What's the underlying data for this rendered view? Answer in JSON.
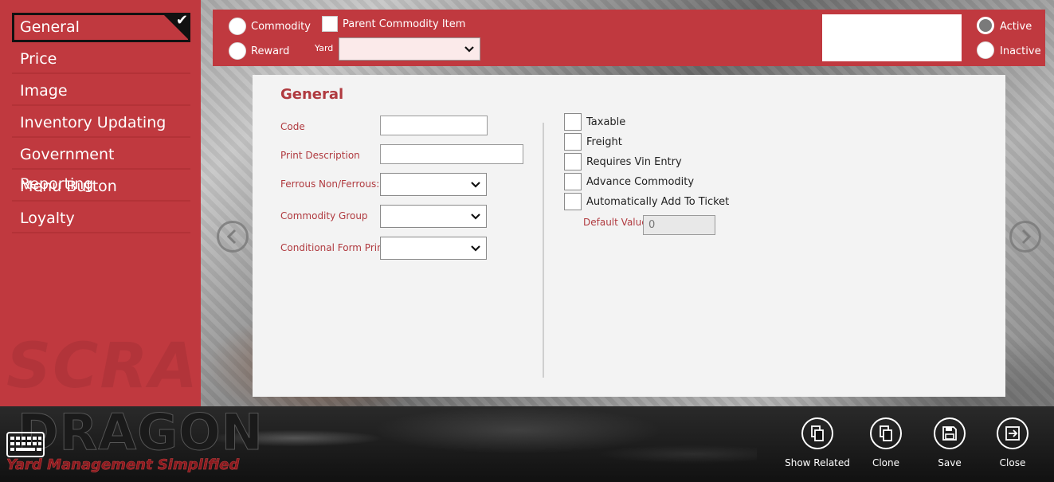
{
  "sidebar": {
    "items": [
      {
        "label": "General",
        "active": true
      },
      {
        "label": "Price"
      },
      {
        "label": "Image"
      },
      {
        "label": "Inventory Updating"
      },
      {
        "label": "Government Reporting"
      },
      {
        "label": "Menu Button"
      },
      {
        "label": "Loyalty"
      }
    ],
    "watermark": "SCRAP"
  },
  "topbar": {
    "commodity_label": "Commodity",
    "reward_label": "Reward",
    "parent_commodity_label": "Parent Commodity Item",
    "yard_label": "Yard",
    "yard_value": "",
    "active_label": "Active",
    "inactive_label": "Inactive",
    "status_selected": "Active"
  },
  "panel": {
    "title": "General",
    "fields": {
      "code_label": "Code",
      "print_description_label": "Print Description",
      "ferrous_label": "Ferrous Non/Ferrous:",
      "commodity_group_label": "Commodity Group",
      "conditional_form_print_label": "Conditional Form Print"
    },
    "checkboxes": [
      {
        "label": "Taxable"
      },
      {
        "label": "Freight"
      },
      {
        "label": "Requires Vin Entry"
      },
      {
        "label": "Advance Commodity"
      },
      {
        "label": "Automatically Add To Ticket"
      }
    ],
    "default_value_label": "Default Value",
    "default_value": "0"
  },
  "footer": {
    "logo_text": "DRAGON",
    "tagline": "Yard Management Simplified",
    "actions": {
      "show_related": "Show Related",
      "clone": "Clone",
      "save": "Save",
      "close": "Close"
    }
  },
  "colors": {
    "accent": "#c0393f",
    "label": "#b03a3f"
  }
}
